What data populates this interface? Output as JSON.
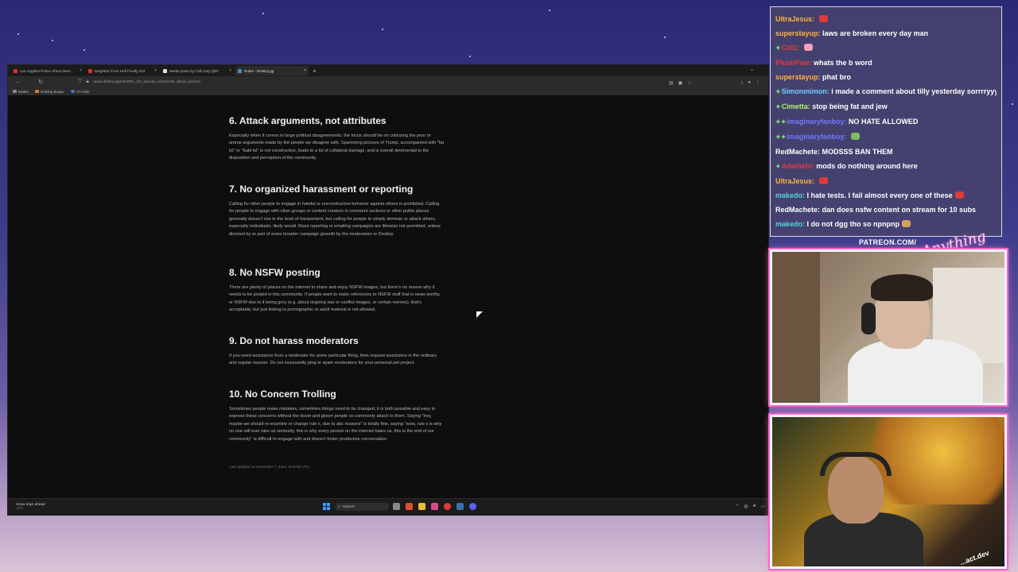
{
  "browser": {
    "tabs": [
      {
        "label": "Los Angeles Police Shoot Wom",
        "color": "#e22d2d",
        "active": false
      },
      {
        "label": "Neighbor From Hell Finally Got",
        "color": "#e22d2d",
        "active": false
      },
      {
        "label": "Media posts by Chili Dog (@R",
        "color": "#dddddd",
        "active": false
      },
      {
        "label": "Rules - Destiny.gg",
        "color": "#4a8bd8",
        "active": true
      }
    ],
    "url": "www.destiny.gg/rules#5._No_sexual_comments_about_women",
    "bookmarks": [
      "Dailies",
      "Nothing Burger",
      "TO ADD"
    ]
  },
  "page": {
    "rules": [
      {
        "title": "6. Attack arguments, not attributes",
        "body": "Especially when it comes to large political disagreements, the focus should be on criticizing the poor or untrue arguments made by the people we disagree with. Spamming pictures of Trump, accompanied with \"fat lol\" or \"bald lol\" is not constructive, leads to a lot of collateral damage, and is overall detrimental to the disposition and perception of the community."
      },
      {
        "title": "7. No organized harassment or reporting",
        "body": "Calling for other people to engage in hateful or unconstructive behavior against others is prohibited. Calling for people to engage with other groups or content creators in comment sections or other public places generally doesn't rise to the level of harassment, but calling for people to simply demean or attack others, especially individuals, likely would. Mass reporting or emailing campaigns are likewise not permitted, unless directed by or part of some broader campaign greenlit by the moderators or Destiny."
      },
      {
        "title": "8. No NSFW posting",
        "body": "There are plenty of places on the internet to share and enjoy NSFW images, but there's no reason why it needs to be posted in this community. If people want to make references to NSFW stuff that is news worthy, or NSFW due to it being gory (e.g. about ongoing war or conflict images, or certain memes), that's acceptable, but just linking to pornographic or adult material is not allowed."
      },
      {
        "title": "9. Do not harass moderators",
        "body": "If you need assistance from a moderator for some particular thing, then request assistance in the ordinary and regular manner. Do not incessantly ping or spam moderators for your personal pet project."
      },
      {
        "title": "10. No Concern Trolling",
        "body": "Sometimes people make mistakes, sometimes things need to be changed, it is both possible and easy to express these concerns without the doom and gloom people so commonly attach to them. Saying \"hey, maybe we should re-examine or change rule x, due to abc reasons\" is totally fine, saying \"wow, rule x is why no one will ever take us seriously, this is why every person on the internet hates us, this is the end of our community\" is difficult to engage with and doesn't foster productive conversation."
      }
    ],
    "last_updated": "Last updated on December 7, 2024, 6:26AM UTC."
  },
  "taskbar": {
    "weather_line1": "Snow days ahead",
    "weather_line2": "-6°C",
    "search_placeholder": "Search"
  },
  "chat": {
    "messages": [
      {
        "user": "UltraJesus:",
        "user_color": "#ffb23e",
        "text": "",
        "emote": "#e03a3a",
        "badge": ""
      },
      {
        "user": "superstayup:",
        "user_color": "#ffb23e",
        "text": "laws are broken every day man",
        "emote": "",
        "badge": ""
      },
      {
        "user": "Cid1:",
        "user_color": "#e23a3a",
        "text": "",
        "emote": "#f0a0c0",
        "badge": "✦"
      },
      {
        "user": "PlushPaw:",
        "user_color": "#e23a3a",
        "text": "whats the b word",
        "emote": "",
        "badge": ""
      },
      {
        "user": "superstayup:",
        "user_color": "#ffb23e",
        "text": "phat bro",
        "emote": "",
        "badge": ""
      },
      {
        "user": "Simonmimon:",
        "user_color": "#6fd0ff",
        "text": "i made a comment about tilly yesterday sorrrryyy",
        "emote": "",
        "badge": "✦"
      },
      {
        "user": "Cimetta:",
        "user_color": "#b5f26d",
        "text": "stop being fat and jew",
        "emote": "",
        "badge": "✦"
      },
      {
        "user": "imaginaryfanboy:",
        "user_color": "#6f7bff",
        "text": "NO HATE ALLOWED",
        "emote": "",
        "badge": "✦✦"
      },
      {
        "user": "imaginaryfanboy:",
        "user_color": "#6f7bff",
        "text": "",
        "emote": "#7ac060",
        "badge": "✦✦"
      },
      {
        "user": "RedMachete:",
        "user_color": "#ffffff",
        "text": "MODSSS BAN THEM",
        "emote": "",
        "badge": ""
      },
      {
        "user": "Adamxhi:",
        "user_color": "#e23a3a",
        "text": "mods do nothing around here",
        "emote": "",
        "badge": "✦"
      },
      {
        "user": "UltraJesus:",
        "user_color": "#ffb23e",
        "text": "",
        "emote": "#e03a3a",
        "badge": ""
      },
      {
        "user": "makedo:",
        "user_color": "#4fd9d9",
        "text": "I hate tests. I fail almost every one of these",
        "emote": "#e03a3a",
        "badge": ""
      },
      {
        "user": "RedMachete:",
        "user_color": "#ffffff",
        "text": "dan does nsfw content on stream for 10 subs",
        "emote": "",
        "badge": ""
      },
      {
        "user": "makedo:",
        "user_color": "#4fd9d9",
        "text": "I do not dgg tho so npnpnp",
        "emote": "#d8a060",
        "badge": ""
      }
    ]
  },
  "overlay": {
    "patreon_label": "PATREON.COM/",
    "brand": "Anything Else",
    "cam2_caption": "...act.dev"
  },
  "colors": {
    "accent_frame": "#ff66cc",
    "page_bg": "#0e0e0e"
  }
}
